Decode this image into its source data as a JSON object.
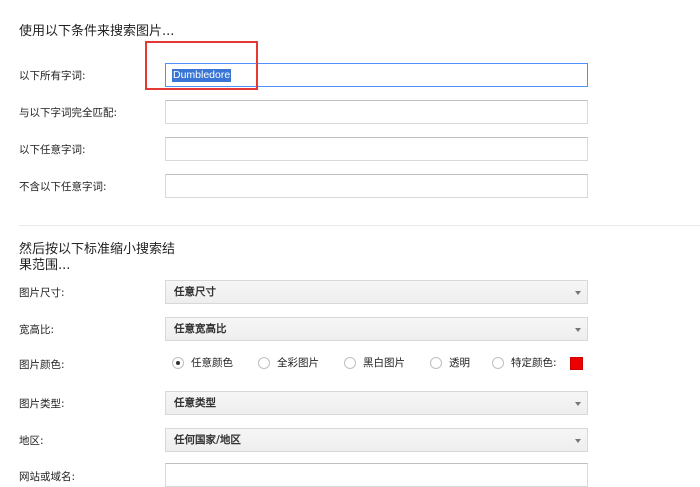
{
  "search_conditions": {
    "title": "使用以下条件来搜索图片...",
    "fields": [
      {
        "label": "以下所有字词:",
        "value": "Dumbledore"
      },
      {
        "label": "与以下字词完全匹配:",
        "value": ""
      },
      {
        "label": "以下任意字词:",
        "value": ""
      },
      {
        "label": "不含以下任意字词:",
        "value": ""
      }
    ]
  },
  "narrow_results": {
    "title": "然后按以下标准缩小搜索结果范围...",
    "size": {
      "label": "图片尺寸:",
      "selected": "任意尺寸"
    },
    "aspect_ratio": {
      "label": "宽高比:",
      "selected": "任意宽高比"
    },
    "color": {
      "label": "图片颜色:",
      "options": [
        "任意颜色",
        "全彩图片",
        "黑白图片",
        "透明",
        "特定颜色:"
      ],
      "selected_index": 0,
      "specific_color": "#ee0000"
    },
    "type": {
      "label": "图片类型:",
      "selected": "任意类型"
    },
    "region": {
      "label": "地区:",
      "selected": "任何国家/地区"
    },
    "site": {
      "label": "网站或域名:",
      "value": ""
    }
  },
  "annotation": {
    "highlight_color": "#e53935"
  }
}
